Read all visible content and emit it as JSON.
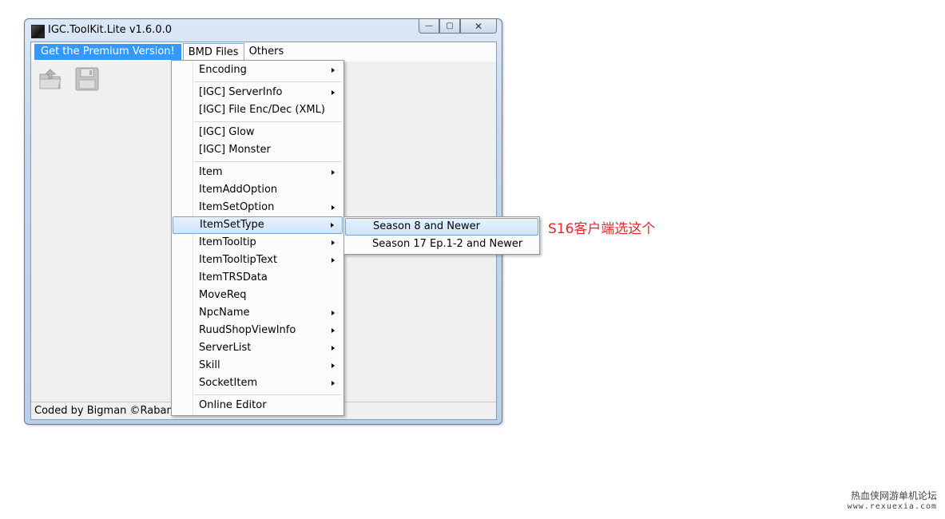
{
  "window": {
    "title": "IGC.ToolKit.Lite v1.6.0.0",
    "minimize": "—",
    "maximize": "▢",
    "close": "✕"
  },
  "menubar": {
    "premium": "Get the Premium Version!",
    "bmd_files": "BMD Files",
    "others": "Others"
  },
  "toolbar": {
    "open_icon": "folder-open-icon",
    "save_icon": "floppy-save-icon"
  },
  "status": {
    "text": "Coded by Bigman ©RabanSoft"
  },
  "dropdown": {
    "items": [
      {
        "label": "Encoding",
        "submenu": true
      },
      {
        "label": "[IGC] ServerInfo",
        "submenu": true
      },
      {
        "label": "[IGC] File Enc/Dec (XML)",
        "submenu": false
      },
      {
        "label": "[IGC] Glow",
        "submenu": false
      },
      {
        "label": "[IGC] Monster",
        "submenu": false
      },
      {
        "label": "Item",
        "submenu": true
      },
      {
        "label": "ItemAddOption",
        "submenu": false
      },
      {
        "label": "ItemSetOption",
        "submenu": true
      },
      {
        "label": "ItemSetType",
        "submenu": true
      },
      {
        "label": "ItemTooltip",
        "submenu": true
      },
      {
        "label": "ItemTooltipText",
        "submenu": true
      },
      {
        "label": "ItemTRSData",
        "submenu": false
      },
      {
        "label": "MoveReq",
        "submenu": false
      },
      {
        "label": "NpcName",
        "submenu": true
      },
      {
        "label": "RuudShopViewInfo",
        "submenu": true
      },
      {
        "label": "ServerList",
        "submenu": true
      },
      {
        "label": "Skill",
        "submenu": true
      },
      {
        "label": "SocketItem",
        "submenu": true
      },
      {
        "label": "Online Editor",
        "submenu": false
      }
    ]
  },
  "submenu": {
    "items": [
      {
        "label": "Season 8 and Newer"
      },
      {
        "label": "Season 17 Ep.1-2 and Newer"
      }
    ]
  },
  "annotation": "S16客户端选这个",
  "watermark": {
    "line1": "热血侠网游单机论坛",
    "line2": "www.rexuexia.com"
  }
}
